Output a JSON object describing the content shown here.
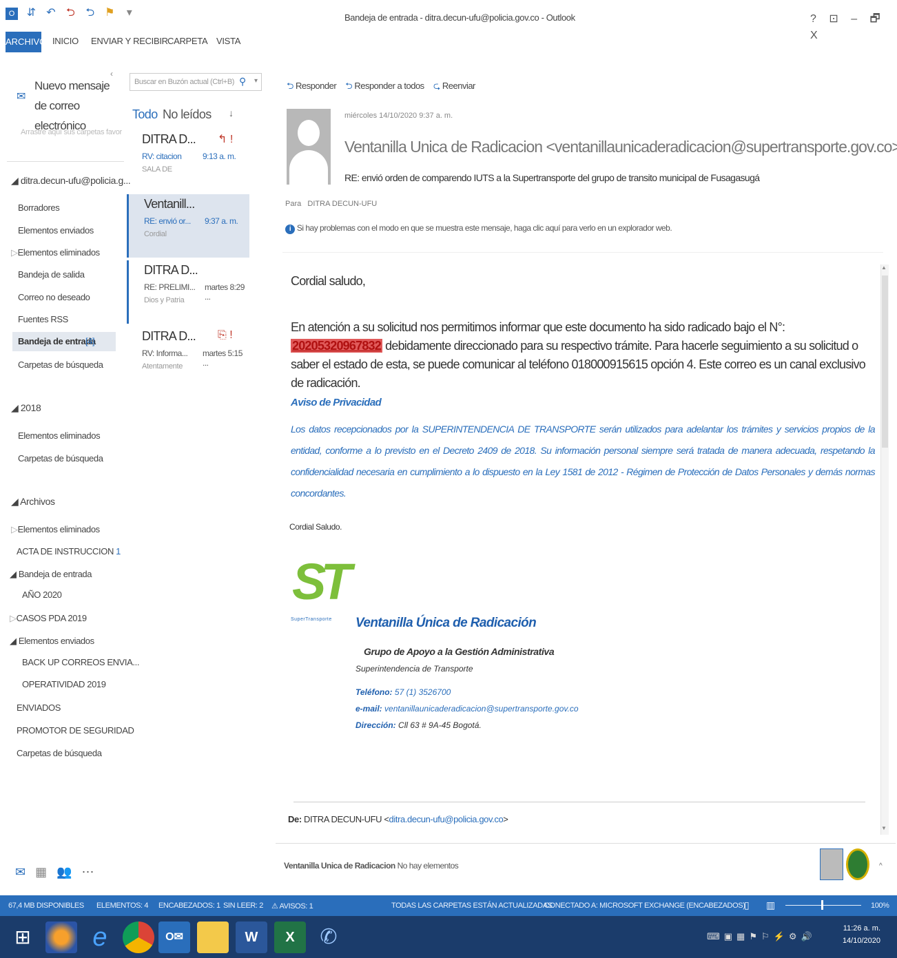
{
  "window": {
    "title": "Bandeja de entrada - ditra.decun-ufu@policia.gov.co - Outlook",
    "controls": [
      "?",
      "⊡",
      "–",
      "🗗",
      "X"
    ]
  },
  "ribbon": {
    "tabs": [
      "ARCHIVO",
      "INICIO",
      "ENVIAR Y RECIBIR",
      "CARPETA",
      "VISTA"
    ]
  },
  "nav": {
    "new_mail": "Nuevo mensaje de correo electrónico",
    "drag_hint": "Arrastre aquí sus carpetas favor",
    "account": "ditra.decun-ufu@policia.g...",
    "account_folders": [
      "Borradores",
      "Elementos enviados",
      "Elementos eliminados",
      "Bandeja de salida",
      "Correo no deseado",
      "Fuentes RSS"
    ],
    "inbox_label": "Bandeja de entrada",
    "inbox_count": "[4]",
    "search_folders": "Carpetas de búsqueda",
    "group_2018": "2018",
    "group_2018_items": [
      "Elementos eliminados",
      "Carpetas de búsqueda"
    ],
    "group_archivos": "Archivos",
    "archivos_items": {
      "deleted": "Elementos eliminados",
      "acta": "ACTA DE INSTRUCCION",
      "acta_count": "1",
      "inbox": "Bandeja de entrada",
      "year": "AÑO 2020",
      "casos": "CASOS PDA 2019",
      "sent": "Elementos enviados",
      "backup": "BACK UP CORREOS ENVIA...",
      "oper": "OPERATIVIDAD 2019",
      "enviados": "ENVIADOS",
      "promotor": "PROMOTOR DE SEGURIDAD",
      "search": "Carpetas de búsqueda"
    }
  },
  "list": {
    "search_placeholder": "Buscar en Buzón actual (Ctrl+B)",
    "filter_all": "Todo",
    "filter_unread": "No leídos",
    "messages": [
      {
        "from": "DITRA D...",
        "subject": "RV: citacion",
        "time": "9:13 a. m.",
        "preview": "SALA DE"
      },
      {
        "from": "Ventanill...",
        "subject": "RE: envió or...",
        "time": "9:37 a. m.",
        "preview": "Cordial"
      },
      {
        "from": "DITRA D...",
        "subject": "RE: PRELIMI...",
        "time": "martes 8:29 ...",
        "preview": "Dios y Patria"
      },
      {
        "from": "DITRA D...",
        "subject": "RV: Informa...",
        "time": "martes 5:15 ...",
        "preview": "Atentamente"
      }
    ]
  },
  "reading": {
    "actions": [
      "Responder",
      "Responder a todos",
      "Reenviar"
    ],
    "date": "miércoles 14/10/2020 9:37 a. m.",
    "sender": "Ventanilla Unica de Radicacion <ventanillaunicaderadicacion@supertransporte.gov.co>",
    "subject": "RE: envió orden de comparendo IUTS a la Supertransporte del grupo de transito municipal de Fusagasugá",
    "to_label": "Para",
    "to": "DITRA DECUN-UFU",
    "info": "Si hay problemas con el modo en que se muestra este mensaje, haga clic aquí para verlo en un explorador web.",
    "greeting": "Cordial saludo,",
    "body_pre": "En atención a su solicitud nos permitimos informar que este documento ha sido radicado bajo el N°: ",
    "radicado": "20205320967832",
    "body_post": " debidamente direccionado para su respectivo trámite. Para hacerle seguimiento a su solicitud o saber el estado de esta, se puede comunicar al teléfono 018000915615 opción 4. Este correo es un canal exclusivo de radicación.",
    "privacy_title": "Aviso de Privacidad",
    "privacy_text": "Los datos recepcionados por la SUPERINTENDENCIA DE TRANSPORTE serán utilizados para adelantar los trámites y servicios propios de la entidad, conforme a lo previsto en el Decreto 2409 de 2018. Su información personal siempre será tratada de manera adecuada, respetando la confidencialidad necesaria en cumplimiento a lo dispuesto en la Ley 1581 de 2012 - Régimen de Protección de Datos Personales y demás normas concordantes.",
    "closing": "Cordial Saludo.",
    "logo_text": "ST",
    "logo_caption": "SuperTransporte",
    "sig_title": "Ventanilla Única de Radicación",
    "sig_group": "Grupo de Apoyo a la Gestión Administrativa",
    "sig_entity": "Superintendencia de Transporte",
    "phone_label": "Teléfono:",
    "phone": "57 (1) 3526700",
    "email_label": "e-mail:",
    "email": "ventanillaunicaderadicacion@supertransporte.gov.co",
    "addr_label": "Dirección:",
    "addr": "Cll 63 # 9A-45 Bogotá.",
    "from_label": "De:",
    "from_name": "DITRA DECUN-UFU",
    "from_email": "ditra.decun-ufu@policia.gov.co",
    "people_name": "Ventanilla Unica de Radicacion",
    "people_empty": "No hay elementos"
  },
  "status": {
    "space": "67,4 MB DISPONIBLES",
    "items": "ELEMENTOS: 4",
    "headers": "ENCABEZADOS: 1",
    "unread": "SIN LEER: 2",
    "alerts": "AVISOS: 1",
    "updated": "TODAS LAS CARPETAS ESTÁN ACTUALIZADAS.",
    "connected": "CONECTADO A: MICROSOFT EXCHANGE (ENCABEZADOS)",
    "zoom": "100%"
  },
  "taskbar": {
    "time": "11:26 a. m.",
    "date": "14/10/2020"
  },
  "colors": {
    "accent": "#2a6ebb",
    "radicado_bg": "#e05a5a"
  }
}
